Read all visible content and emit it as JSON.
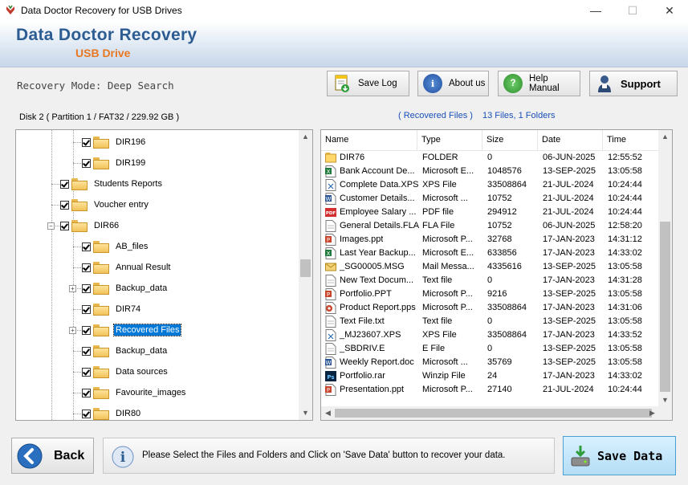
{
  "window": {
    "title": "Data Doctor Recovery for USB Drives",
    "minimize": "—",
    "maximize": "☐",
    "close": "✕"
  },
  "header": {
    "brand": "Data Doctor Recovery",
    "sub": "USB Drive"
  },
  "toolbar": {
    "mode": "Recovery Mode: Deep Search",
    "save_log": "Save Log",
    "about": "About us",
    "help": "Help Manual",
    "support": "Support"
  },
  "disk_label": "Disk 2 ( Partition 1 / FAT32 / 229.92 GB )",
  "recovered_label": "( Recovered Files )",
  "recovered_count": "13 Files, 1 Folders",
  "tree": [
    {
      "label": "DIR196",
      "level": 2,
      "selected": false,
      "expander": false
    },
    {
      "label": "DIR199",
      "level": 2,
      "selected": false,
      "expander": false
    },
    {
      "label": "Students Reports",
      "level": 1,
      "selected": false,
      "expander": false
    },
    {
      "label": "Voucher entry",
      "level": 1,
      "selected": false,
      "expander": false
    },
    {
      "label": "DIR66",
      "level": 1,
      "selected": false,
      "expander": "minus"
    },
    {
      "label": "AB_files",
      "level": 2,
      "selected": false,
      "expander": false
    },
    {
      "label": "Annual Result",
      "level": 2,
      "selected": false,
      "expander": false
    },
    {
      "label": "Backup_data",
      "level": 2,
      "selected": false,
      "expander": "plus"
    },
    {
      "label": "DIR74",
      "level": 2,
      "selected": false,
      "expander": false
    },
    {
      "label": "Recovered Files",
      "level": 2,
      "selected": true,
      "expander": "plus"
    },
    {
      "label": "Backup_data",
      "level": 2,
      "selected": false,
      "expander": false
    },
    {
      "label": "Data sources",
      "level": 2,
      "selected": false,
      "expander": false
    },
    {
      "label": "Favourite_images",
      "level": 2,
      "selected": false,
      "expander": false
    },
    {
      "label": "DIR80",
      "level": 2,
      "selected": false,
      "expander": false
    }
  ],
  "columns": [
    "Name",
    "Type",
    "Size",
    "Date",
    "Time"
  ],
  "files": [
    {
      "icon": "folder",
      "name": "DIR76",
      "type": "FOLDER",
      "size": "0",
      "date": "06-JUN-2025",
      "time": "12:55:52"
    },
    {
      "icon": "excel",
      "name": "Bank Account De...",
      "type": "Microsoft E...",
      "size": "1048576",
      "date": "13-SEP-2025",
      "time": "13:05:58"
    },
    {
      "icon": "xps",
      "name": "Complete Data.XPS",
      "type": "XPS File",
      "size": "33508864",
      "date": "21-JUL-2024",
      "time": "10:24:44"
    },
    {
      "icon": "word",
      "name": "Customer Details...",
      "type": "Microsoft ...",
      "size": "10752",
      "date": "21-JUL-2024",
      "time": "10:24:44"
    },
    {
      "icon": "pdf",
      "name": "Employee Salary ...",
      "type": "PDF file",
      "size": "294912",
      "date": "21-JUL-2024",
      "time": "10:24:44"
    },
    {
      "icon": "generic",
      "name": "General Details.FLA",
      "type": "FLA File",
      "size": "10752",
      "date": "06-JUN-2025",
      "time": "12:58:20"
    },
    {
      "icon": "ppt",
      "name": "Images.ppt",
      "type": "Microsoft P...",
      "size": "32768",
      "date": "17-JAN-2023",
      "time": "14:31:12"
    },
    {
      "icon": "excel",
      "name": "Last Year Backup...",
      "type": "Microsoft E...",
      "size": "633856",
      "date": "17-JAN-2023",
      "time": "14:33:02"
    },
    {
      "icon": "mail",
      "name": "_SG00005.MSG",
      "type": "Mail Messa...",
      "size": "4335616",
      "date": "13-SEP-2025",
      "time": "13:05:58"
    },
    {
      "icon": "generic",
      "name": "New Text Docum...",
      "type": "Text file",
      "size": "0",
      "date": "17-JAN-2023",
      "time": "14:31:28"
    },
    {
      "icon": "ppt",
      "name": "Portfolio.PPT",
      "type": "Microsoft P...",
      "size": "9216",
      "date": "13-SEP-2025",
      "time": "13:05:58"
    },
    {
      "icon": "pps",
      "name": "Product Report.pps",
      "type": "Microsoft P...",
      "size": "33508864",
      "date": "17-JAN-2023",
      "time": "14:31:06"
    },
    {
      "icon": "generic",
      "name": "Text File.txt",
      "type": "Text file",
      "size": "0",
      "date": "13-SEP-2025",
      "time": "13:05:58"
    },
    {
      "icon": "xps",
      "name": "_MJ23607.XPS",
      "type": "XPS File",
      "size": "33508864",
      "date": "17-JAN-2023",
      "time": "14:33:52"
    },
    {
      "icon": "generic",
      "name": "_SBDRIV.E",
      "type": "E File",
      "size": "0",
      "date": "13-SEP-2025",
      "time": "13:05:58"
    },
    {
      "icon": "word",
      "name": "Weekly Report.doc",
      "type": "Microsoft ...",
      "size": "35769",
      "date": "13-SEP-2025",
      "time": "13:05:58"
    },
    {
      "icon": "ps",
      "name": "Portfolio.rar",
      "type": "Winzip File",
      "size": "24",
      "date": "17-JAN-2023",
      "time": "14:33:02"
    },
    {
      "icon": "ppt",
      "name": "Presentation.ppt",
      "type": "Microsoft P...",
      "size": "27140",
      "date": "21-JUL-2024",
      "time": "10:24:44"
    }
  ],
  "bottom": {
    "back": "Back",
    "message": "Please Select the Files and Folders and Click on 'Save Data' button to recover your data.",
    "save": "Save Data"
  },
  "colors": {
    "brand_blue": "#2c5c92",
    "brand_orange": "#e87722",
    "link_blue": "#1a4fb8",
    "selection": "#0078d7"
  }
}
